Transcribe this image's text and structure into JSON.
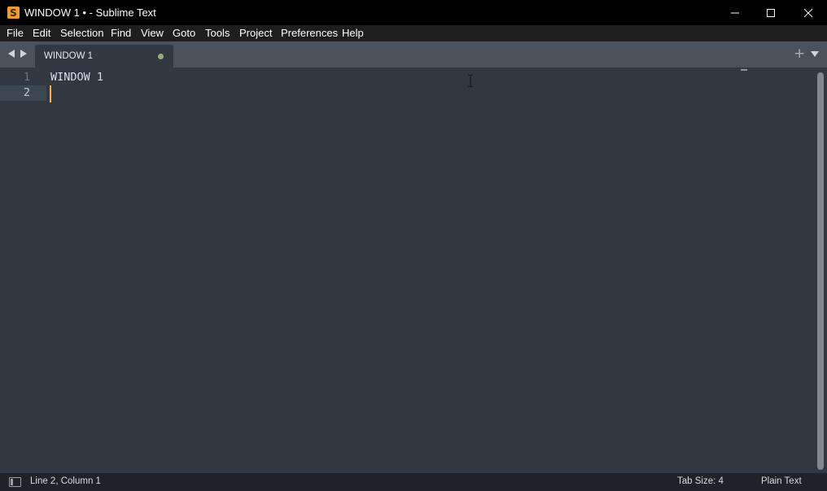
{
  "window": {
    "title": "WINDOW 1 • - Sublime Text",
    "icon": "sublime-text-logo-icon",
    "icon_glyph": "S",
    "controls": [
      "minimize-icon",
      "maximize-icon",
      "close-icon"
    ]
  },
  "menu": {
    "items": [
      "File",
      "Edit",
      "Selection",
      "Find",
      "View",
      "Goto",
      "Tools",
      "Project",
      "Preferences",
      "Help"
    ]
  },
  "tabs": {
    "nav_icons": [
      "chevron-left-icon",
      "chevron-right-icon"
    ],
    "active": {
      "label": "WINDOW 1",
      "modified": true,
      "dirty_color": "#8fb573"
    },
    "new_tab_glyph": "+",
    "tab_list_icon": "caret-down-icon"
  },
  "editor": {
    "lines": [
      {
        "number": "1",
        "text": "WINDOW 1"
      },
      {
        "number": "2",
        "text": ""
      }
    ],
    "current_line": 2,
    "caret_color": "#f9ae58",
    "background": "#303841"
  },
  "status": {
    "position": "Line 2, Column 1",
    "tab_size": "Tab Size: 4",
    "syntax": "Plain Text",
    "panel_icon": "toggle-panel-icon"
  }
}
